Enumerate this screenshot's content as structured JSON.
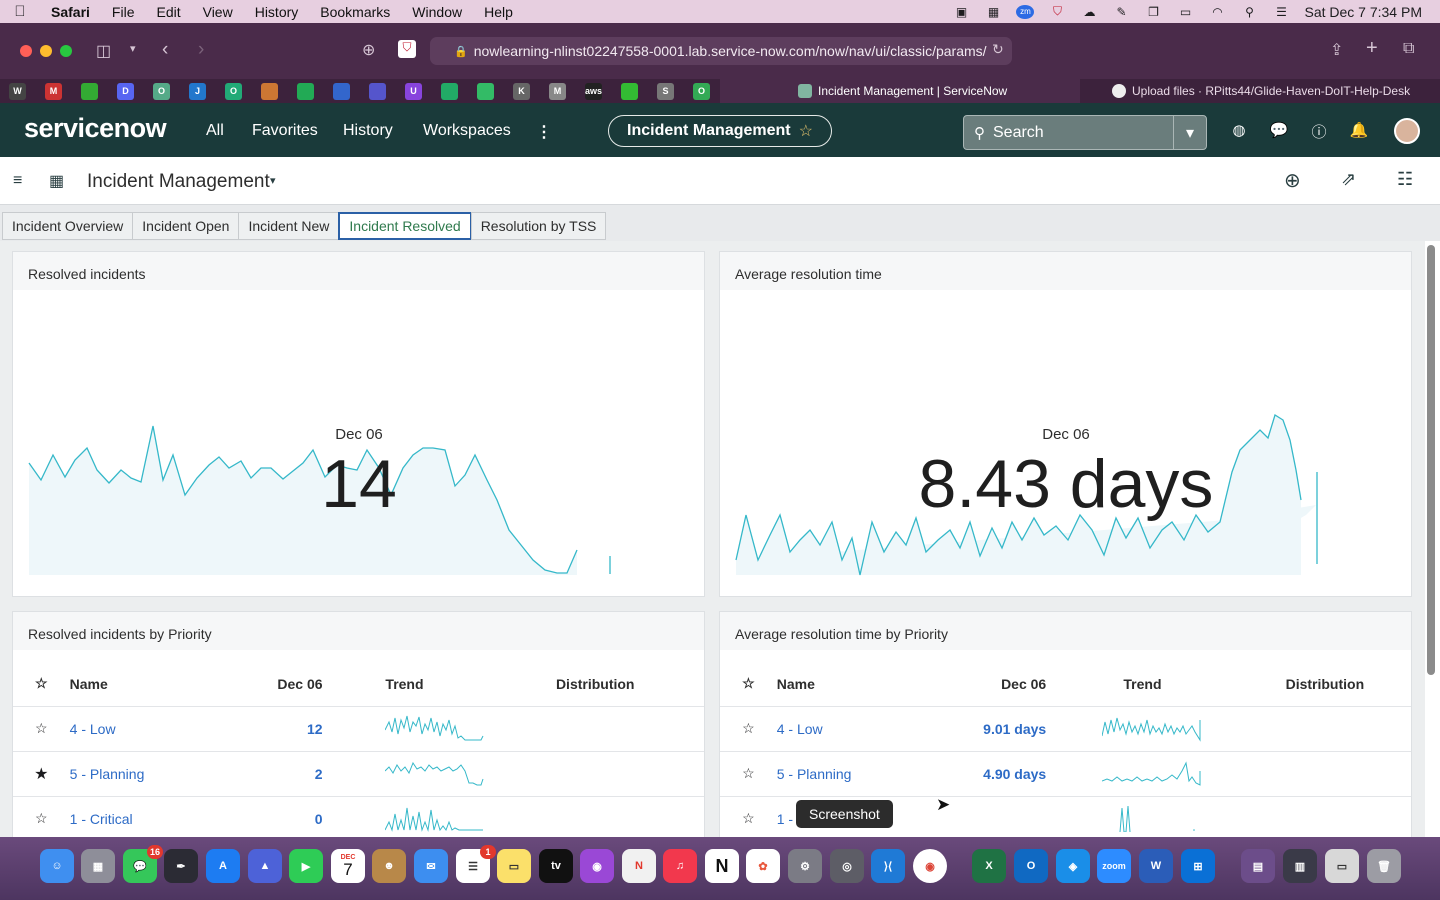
{
  "menubar": {
    "app": "Safari",
    "items": [
      "File",
      "Edit",
      "View",
      "History",
      "Bookmarks",
      "Window",
      "Help"
    ],
    "datetime": "Sat Dec 7  7:34 PM"
  },
  "browser": {
    "url": "nowlearning-nlinst02247558-0001.lab.service-now.com/now/nav/ui/classic/params/",
    "tabs": [
      {
        "title": "Incident Management | ServiceNow",
        "active": true
      },
      {
        "title": "Upload files · RPitts44/Glide-Haven-DoIT-Help-Desk",
        "active": false
      }
    ],
    "favorite_icons": [
      "W",
      "M",
      "",
      "D",
      "O",
      "J",
      "O",
      "",
      "",
      "",
      "",
      "U",
      "",
      "",
      "K",
      "M",
      "aws",
      "",
      "S",
      "O"
    ]
  },
  "sn_header": {
    "logo": "servicenow",
    "nav": [
      "All",
      "Favorites",
      "History",
      "Workspaces"
    ],
    "more": "⋮",
    "context_title": "Incident Management",
    "search_placeholder": "Search"
  },
  "titlebar": {
    "title": "Incident Management"
  },
  "dashboard_tabs": [
    {
      "label": "Incident Overview",
      "active": false
    },
    {
      "label": "Incident Open",
      "active": false
    },
    {
      "label": "Incident New",
      "active": false
    },
    {
      "label": "Incident Resolved",
      "active": true
    },
    {
      "label": "Resolution by TSS",
      "active": false
    }
  ],
  "panels": {
    "resolved": {
      "title": "Resolved incidents",
      "date": "Dec 06",
      "value": "14"
    },
    "avg_time": {
      "title": "Average resolution time",
      "date": "Dec 06",
      "value": "8.43 days"
    },
    "resolved_by_priority": {
      "title": "Resolved incidents by Priority",
      "columns": [
        "Name",
        "Dec 06",
        "Trend",
        "Distribution"
      ],
      "rows": [
        {
          "name": "4 - Low",
          "value": "12",
          "starred": false
        },
        {
          "name": "5 - Planning",
          "value": "2",
          "starred": true
        },
        {
          "name": "1 - Critical",
          "value": "0",
          "starred": false
        }
      ]
    },
    "avg_time_by_priority": {
      "title": "Average resolution time by Priority",
      "columns": [
        "Name",
        "Dec 06",
        "Trend",
        "Distribution"
      ],
      "rows": [
        {
          "name": "4 - Low",
          "value": "9.01 days",
          "starred": false
        },
        {
          "name": "5 - Planning",
          "value": "4.90 days",
          "starred": false
        },
        {
          "name": "1 - ",
          "value": "",
          "starred": false
        }
      ]
    }
  },
  "tooltip": "Screenshot",
  "dock": {
    "messages_badge": "16",
    "calendar_month": "DEC",
    "calendar_day": "7",
    "reminders_badge": "1"
  },
  "colors": {
    "sn_header_bg": "#1a3a3a",
    "sparkline_stroke": "#35b8c9",
    "sparkline_fill": "#eef7fa",
    "link_blue": "#2d6bc6",
    "active_tab_border": "#2b60a6"
  }
}
